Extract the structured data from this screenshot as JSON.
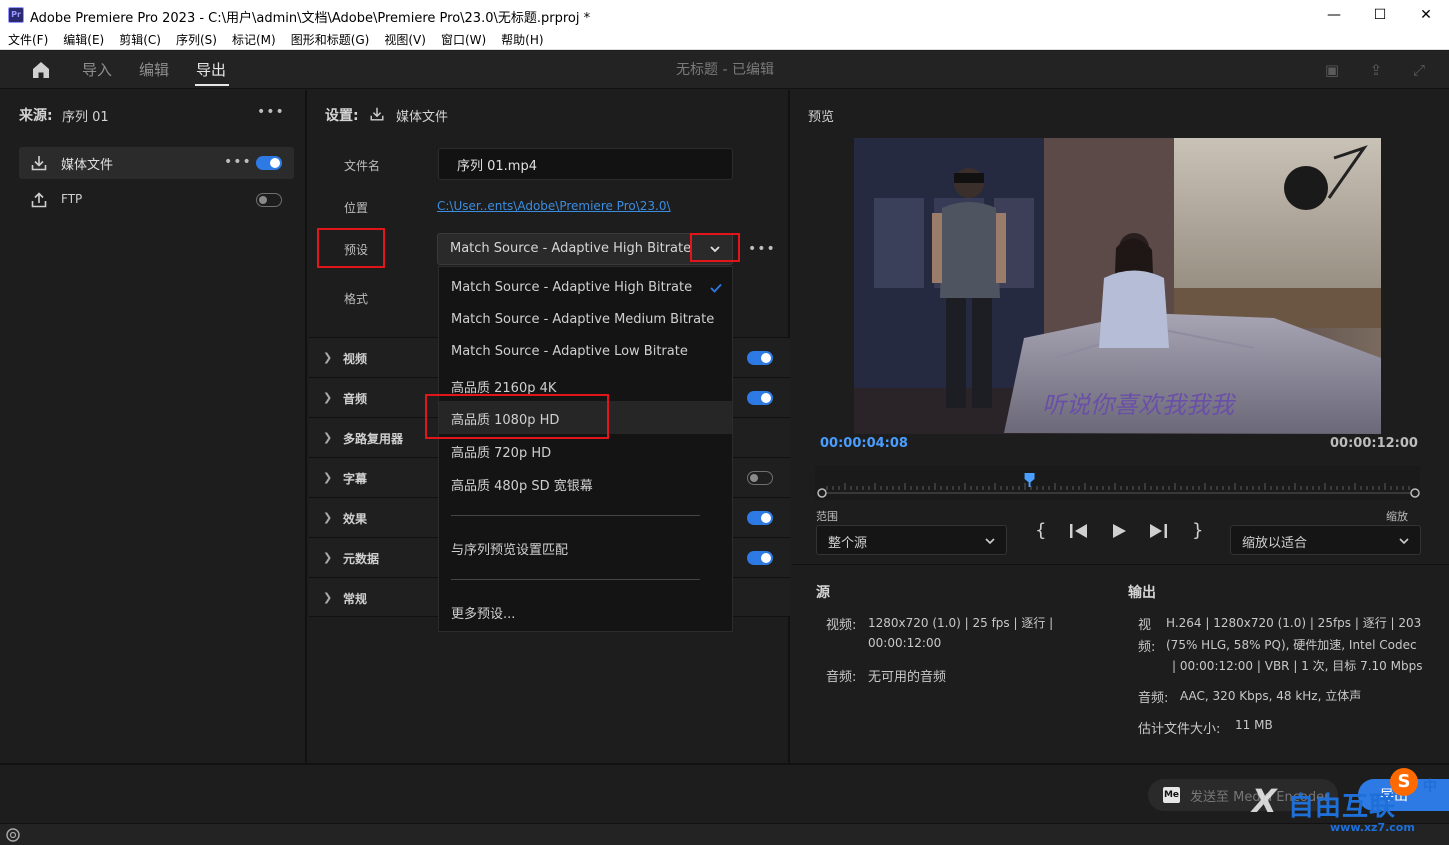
{
  "window": {
    "title": "Adobe Premiere Pro 2023 - C:\\用户\\admin\\文档\\Adobe\\Premiere Pro\\23.0\\无标题.prproj *",
    "app_icon": "Pr",
    "minimize": "—",
    "maximize": "☐",
    "close": "✕"
  },
  "menu": [
    "文件(F)",
    "编辑(E)",
    "剪辑(C)",
    "序列(S)",
    "标记(M)",
    "图形和标题(G)",
    "视图(V)",
    "窗口(W)",
    "帮助(H)"
  ],
  "nav": {
    "tabs": [
      "导入",
      "编辑",
      "导出"
    ],
    "active": "导出",
    "doc_title": "无标题 - 已编辑"
  },
  "source": {
    "label": "来源:",
    "sequence": "序列 01",
    "destinations": [
      {
        "label": "媒体文件",
        "enabled": true
      },
      {
        "label": "FTP",
        "enabled": false
      }
    ]
  },
  "settings": {
    "label": "设置:",
    "target": "媒体文件",
    "filename_label": "文件名",
    "filename": "序列 01.mp4",
    "location_label": "位置",
    "location": "C:\\User..ents\\Adobe\\Premiere Pro\\23.0\\",
    "preset_label": "预设",
    "preset_value": "Match Source - Adaptive High Bitrate",
    "format_label": "格式",
    "sections": [
      {
        "name": "视频",
        "toggle": true
      },
      {
        "name": "音频",
        "toggle": true
      },
      {
        "name": "多路复用器",
        "toggle": null
      },
      {
        "name": "字幕",
        "toggle": false
      },
      {
        "name": "效果",
        "toggle": true
      },
      {
        "name": "元数据",
        "toggle": true
      },
      {
        "name": "常规",
        "toggle": null
      }
    ]
  },
  "preset_menu": {
    "items": [
      "Match Source - Adaptive High Bitrate",
      "Match Source - Adaptive Medium Bitrate",
      "Match Source - Adaptive Low Bitrate",
      "高品质 2160p 4K",
      "高品质 1080p HD",
      "高品质 720p HD",
      "高品质 480p SD 宽银幕"
    ],
    "checked": "Match Source - Adaptive High Bitrate",
    "highlighted": "高品质 1080p HD",
    "match_sequence": "与序列预览设置匹配",
    "more_presets": "更多预设..."
  },
  "preview": {
    "label": "预览",
    "subtitle": "听说你喜欢我我我",
    "current_time": "00:00:04:08",
    "end_time": "00:00:12:00",
    "playhead_fraction": 0.35,
    "range_label": "范围",
    "range_value": "整个源",
    "zoom_label": "缩放",
    "zoom_value": "缩放以适合"
  },
  "source_info": {
    "heading": "源",
    "video_label": "视频:",
    "video_line1": "1280x720 (1.0)  |  25 fps  |  逐行  |",
    "video_line2": "00:00:12:00",
    "audio_label": "音频:",
    "audio_value": "无可用的音频"
  },
  "output_info": {
    "heading": "输出",
    "video_label_1": "视",
    "video_label_2": "频:",
    "video_line1": "H.264  |  1280x720 (1.0)  |  25fps  |  逐行  |  203",
    "video_line2": "(75% HLG, 58% PQ), 硬件加速, Intel Codec",
    "video_line3": "|  00:00:12:00  |  VBR  |  1 次, 目标 7.10 Mbps",
    "audio_label": "音频:",
    "audio_value": "AAC, 320 Kbps, 48 kHz, 立体声",
    "size_label": "估计文件大小:",
    "size_value": "11 MB"
  },
  "bottom": {
    "send_label": "发送至 Media Encoder",
    "me_icon": "Me",
    "export_label": "导出"
  },
  "watermark": {
    "text": "自由互联",
    "url": "www.xz7.com",
    "s_badge": "S",
    "zh_badge": "中"
  },
  "colors": {
    "accent": "#2d7ae5",
    "highlight": "#e0161b",
    "timecode": "#4a9eff",
    "subtitle": "#6a4fa8"
  }
}
